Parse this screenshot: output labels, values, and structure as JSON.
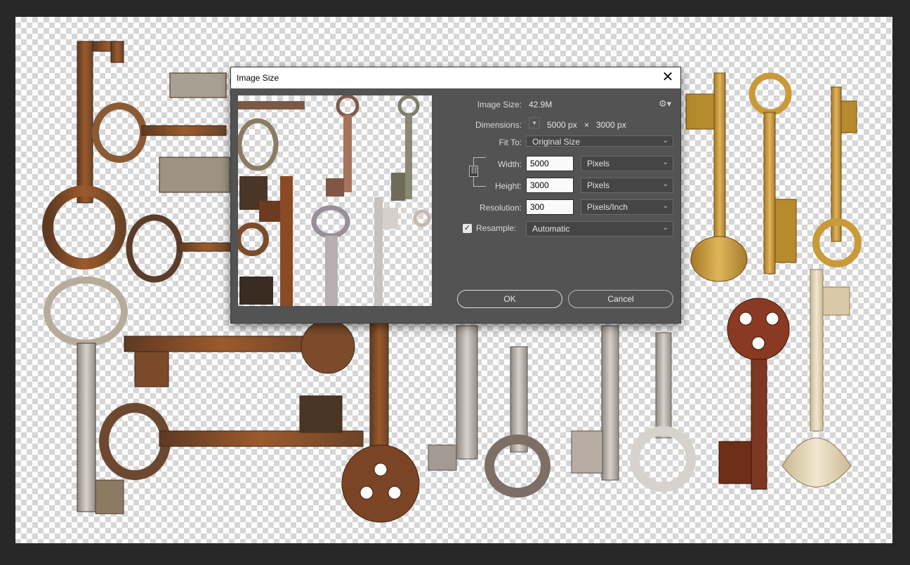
{
  "dialog": {
    "title": "Image Size",
    "close_glyph": "✕",
    "image_size_label": "Image Size:",
    "image_size_value": "42.9M",
    "settings_icon": "gear-icon",
    "dimensions_label": "Dimensions:",
    "dimensions_width": "5000 px",
    "dimensions_times": "×",
    "dimensions_height": "3000 px",
    "fit_to_label": "Fit To:",
    "fit_to_value": "Original Size",
    "width_label": "Width:",
    "width_value": "5000",
    "width_unit": "Pixels",
    "height_label": "Height:",
    "height_value": "3000",
    "height_unit": "Pixels",
    "resolution_label": "Resolution:",
    "resolution_value": "300",
    "resolution_unit": "Pixels/Inch",
    "resample_label": "Resample:",
    "resample_checked": true,
    "resample_value": "Automatic",
    "ok_label": "OK",
    "cancel_label": "Cancel"
  },
  "colors": {
    "workspace": "#282828",
    "dialog_bg": "#535353",
    "rust": "#7a4424",
    "gold": "#c99a3a",
    "silver": "#b9b3ad",
    "ornate": "#8a3a22",
    "pale": "#e5d6b8"
  }
}
